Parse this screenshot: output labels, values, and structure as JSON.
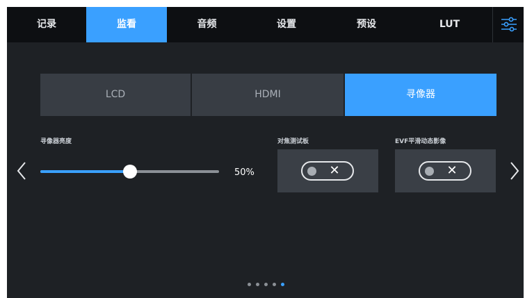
{
  "tabs": [
    {
      "label": "记录",
      "active": false
    },
    {
      "label": "监看",
      "active": true
    },
    {
      "label": "音频",
      "active": false
    },
    {
      "label": "设置",
      "active": false
    },
    {
      "label": "预设",
      "active": false
    },
    {
      "label": "LUT",
      "active": false
    }
  ],
  "menu_icon": "sliders-icon",
  "segments": [
    {
      "label": "LCD",
      "active": false
    },
    {
      "label": "HDMI",
      "active": false
    },
    {
      "label": "寻像器",
      "active": true
    }
  ],
  "brightness": {
    "label": "寻像器亮度",
    "value_text": "50%",
    "value": 0.5
  },
  "focus_chart": {
    "label": "对焦测试板",
    "enabled": false
  },
  "evf_smoothing": {
    "label": "EVF平滑动态影像",
    "enabled": false
  },
  "toggle_off_glyph": "✕",
  "pagination": {
    "total": 5,
    "current": 5
  },
  "colors": {
    "accent": "#3aa0ff",
    "background": "#1e2125",
    "tabbar": "#0d0f12",
    "segment": "#383d44"
  }
}
